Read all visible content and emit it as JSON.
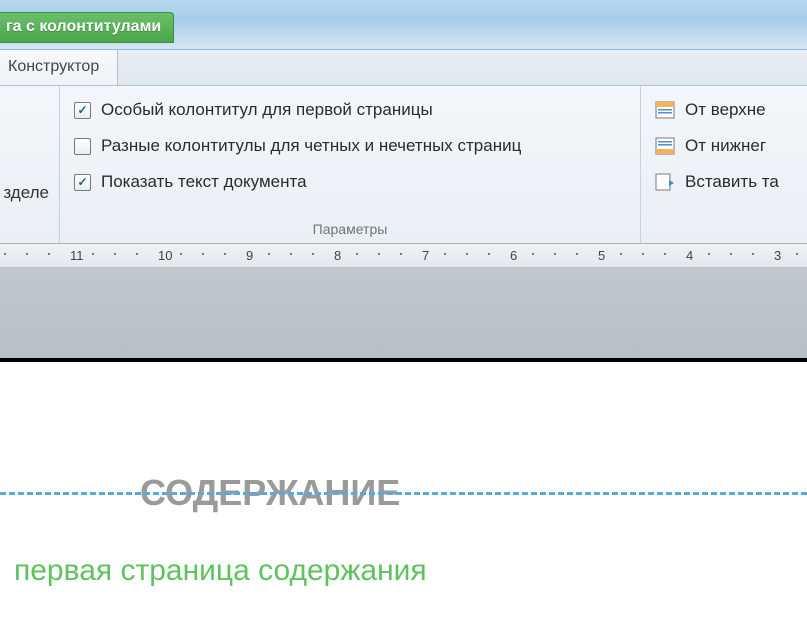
{
  "titleTab": "га с колонтитулами",
  "activeTab": "Конструктор",
  "leftFragment": "зделе",
  "options": {
    "firstPageDifferent": {
      "label": "Особый колонтитул для первой страницы",
      "checked": true
    },
    "oddEvenDifferent": {
      "label": "Разные колонтитулы для четных и нечетных страниц",
      "checked": false
    },
    "showDocText": {
      "label": "Показать текст документа",
      "checked": true
    }
  },
  "groupCaption": "Параметры",
  "rightItems": {
    "fromTop": "От верхне",
    "fromBottom": "От нижнег",
    "insertTab": "Вставить та"
  },
  "ruler": {
    "start": 11,
    "end": 3
  },
  "document": {
    "heading": "СОДЕРЖАНИЕ",
    "subline": "первая страница содержания"
  }
}
